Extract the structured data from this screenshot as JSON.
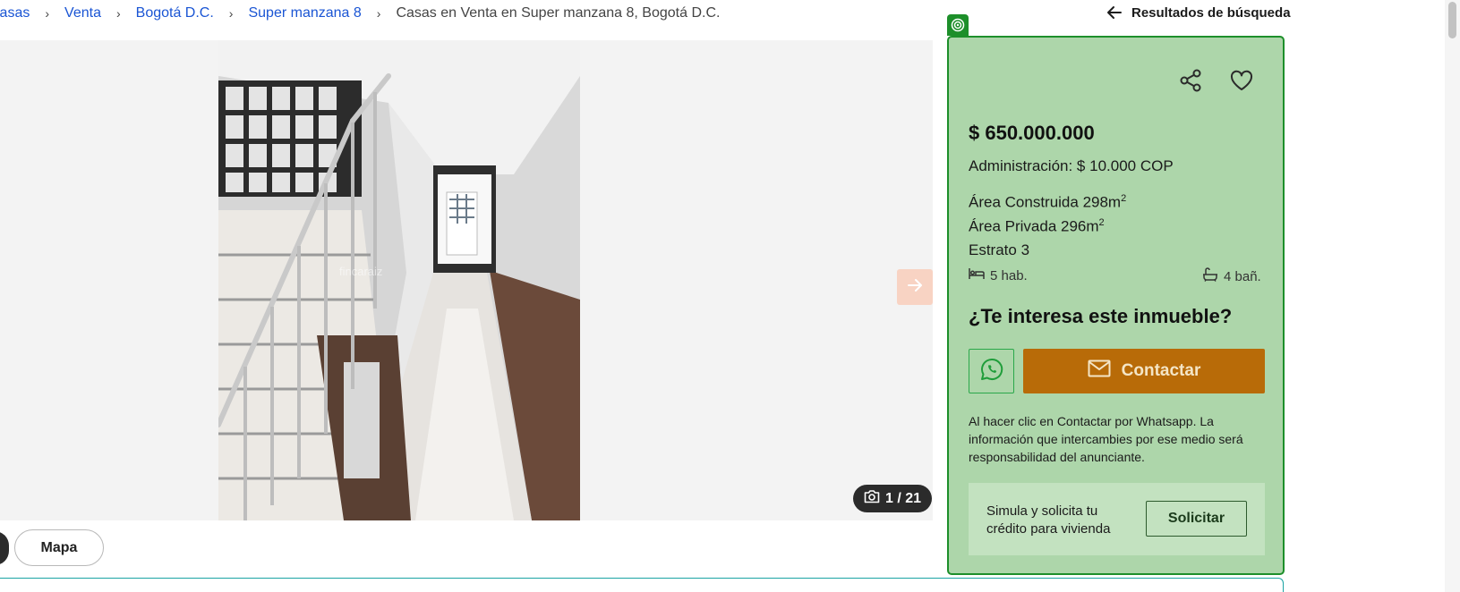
{
  "breadcrumb": {
    "items": [
      {
        "label": "Casas"
      },
      {
        "label": "Venta"
      },
      {
        "label": "Bogotá D.C."
      },
      {
        "label": "Super manzana 8"
      }
    ],
    "current": "Casas en Venta en Super manzana 8, Bogotá D.C.",
    "separator": "›"
  },
  "back_link": {
    "label": "Resultados de búsqueda",
    "icon": "arrow-left-icon"
  },
  "gallery": {
    "counter": "1 / 21",
    "counter_icon": "camera-icon",
    "watermark": "fincaraiz",
    "next_icon": "arrow-right-icon"
  },
  "bottom_buttons": {
    "map_label": "Mapa"
  },
  "listing": {
    "price": "$ 650.000.000",
    "administration": "Administración: $ 10.000 COP",
    "built_area_label": "Área Construida 298m",
    "private_area_label": "Área Privada 296m",
    "area_unit_sup": "2",
    "estrato": "Estrato 3",
    "rooms": "5 hab.",
    "baths": "4 bañ."
  },
  "contact": {
    "heading": "¿Te interesa este inmueble?",
    "contact_label": "Contactar",
    "disclaimer": "Al hacer clic en Contactar por Whatsapp. La información que intercambies por ese medio será responsabilidad del anunciante.",
    "credit_text": "Simula y solicita tu crédito para vivienda",
    "credit_button": "Solicitar"
  },
  "colors": {
    "panel_bg": "#add6aa",
    "panel_border": "#1d8f2a",
    "contact_button": "#b86b08",
    "link": "#1a55d4",
    "next_button": "#f8d3c3"
  }
}
